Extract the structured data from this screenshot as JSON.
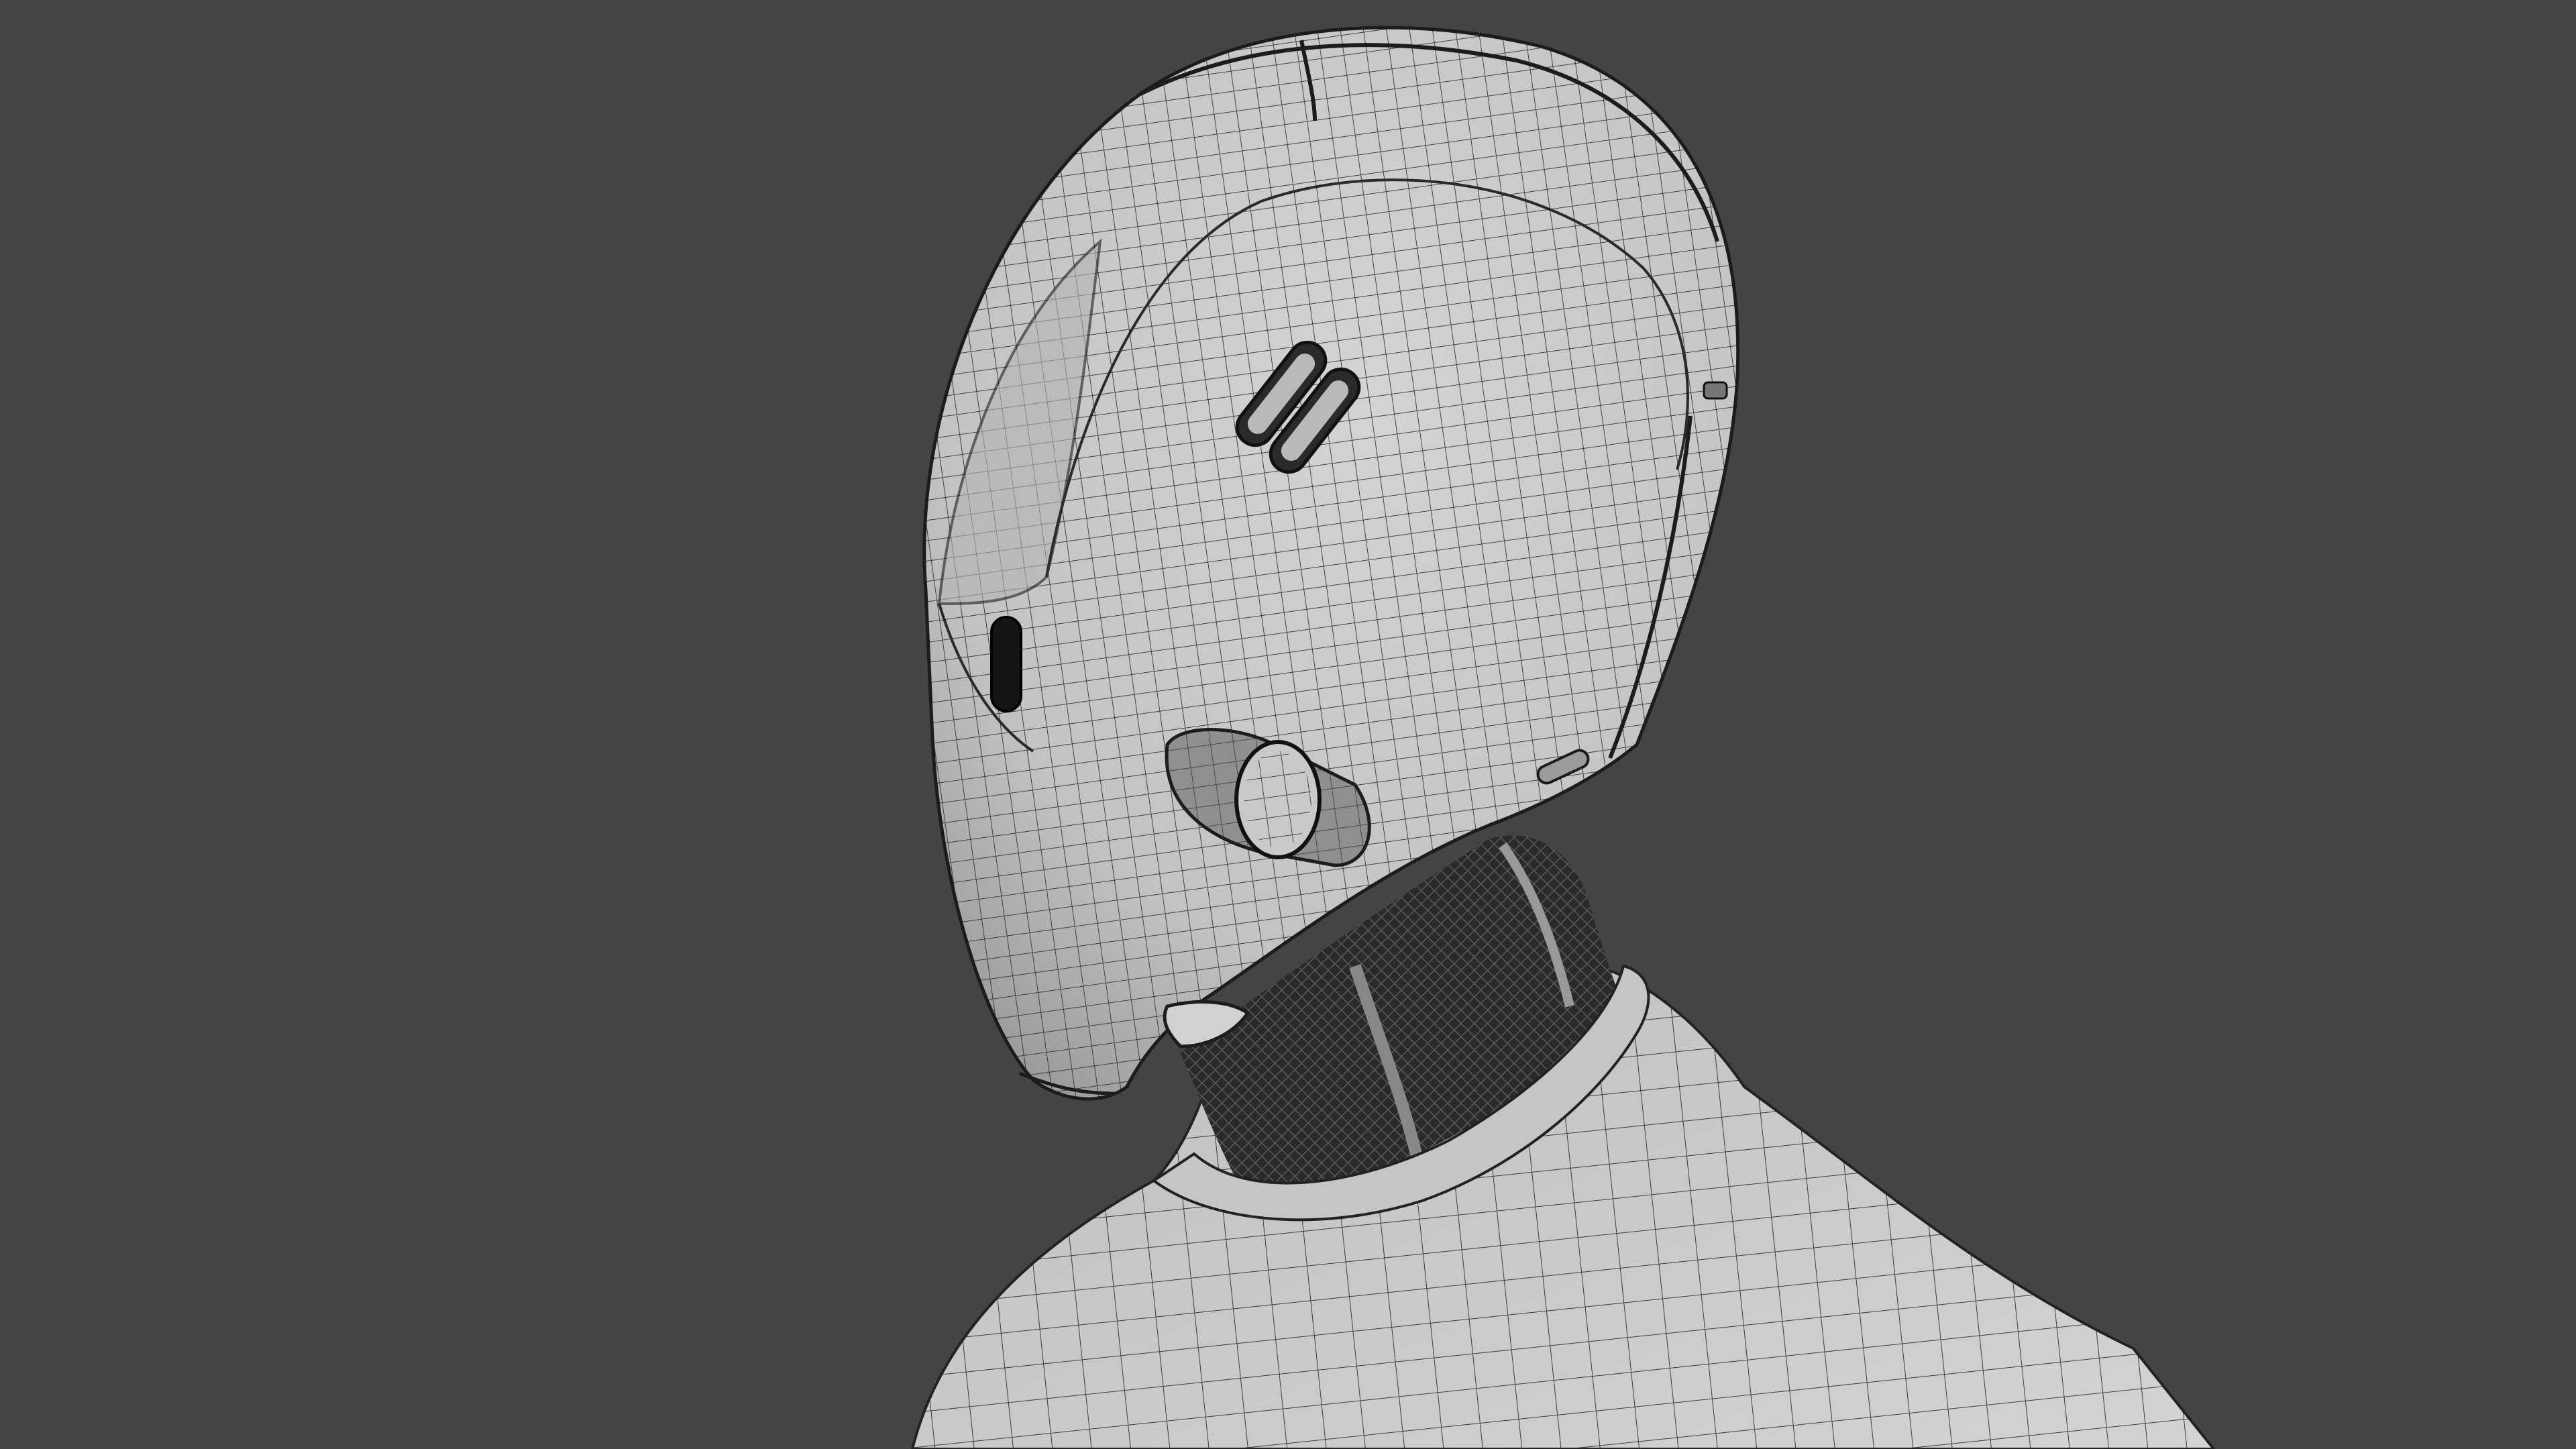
{
  "scene": {
    "subject": "wireframe-robot-head-bust",
    "shading": "solid-gray-with-wire-overlay",
    "colors": {
      "background": "#444444",
      "surface": "#c6c7c6",
      "surface_shadow": "#9a9b9a",
      "wire": "#2a2a2a",
      "cavity": "#1a1a1a"
    }
  }
}
